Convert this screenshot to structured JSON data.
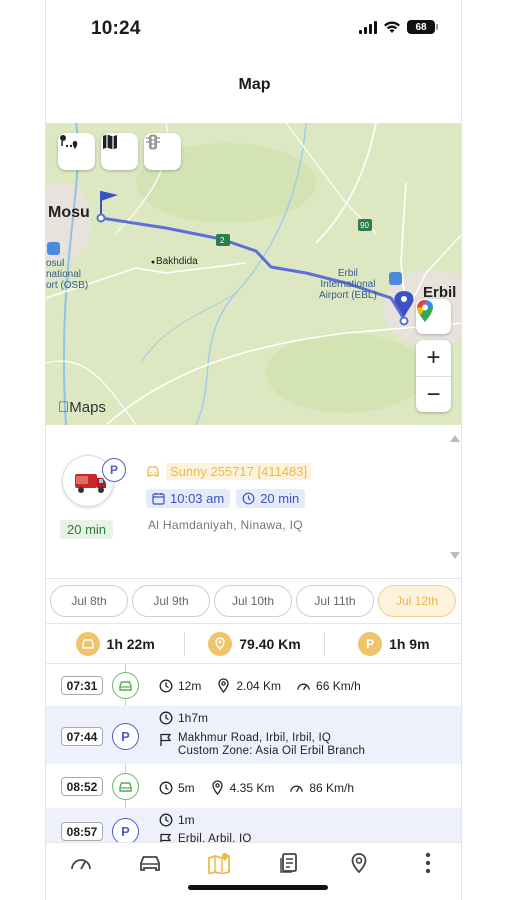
{
  "status_bar": {
    "time": "10:24",
    "battery": "68"
  },
  "page": {
    "title": "Map"
  },
  "map": {
    "labels": {
      "mosul": "Mosu",
      "mosul_airport": "osul\nnational\nort (OSB)",
      "bakhdida": "Bakhdida",
      "erbil_airport": "Erbil\nInternational\nAirport (EBL)",
      "erbil": "Erbil",
      "road_2": "2",
      "road_90": "90"
    },
    "attribution": "Maps",
    "controls": {
      "zoom_in": "+",
      "zoom_out": "−"
    }
  },
  "vehicle": {
    "badge": "P",
    "duration": "20 min",
    "name": "Sunny 255717 [411483]",
    "start_time": "10:03 am",
    "elapsed": "20 min",
    "address": "Al Hamdaniyah, Ninawa, IQ"
  },
  "dates": [
    "Jul 8th",
    "Jul 9th",
    "Jul 10th",
    "Jul 11th",
    "Jul 12th"
  ],
  "active_date": "Jul 12th",
  "summary": {
    "drive_time": "1h 22m",
    "distance": "79.40 Km",
    "parking_badge": "P",
    "parked_time": "1h 9m"
  },
  "timeline": [
    {
      "time": "07:31",
      "type": "move",
      "duration": "12m",
      "distance": "2.04 Km",
      "speed": "66 Km/h"
    },
    {
      "time": "07:44",
      "type": "park",
      "badge": "P",
      "duration": "1h7m",
      "address_line1": "Makhmur Road, Irbil, Irbil, IQ",
      "address_line2": "Custom Zone: Asia Oil Erbil Branch"
    },
    {
      "time": "08:52",
      "type": "move",
      "duration": "5m",
      "distance": "4.35 Km",
      "speed": "86 Km/h"
    },
    {
      "time": "08:57",
      "type": "park",
      "badge": "P",
      "duration": "1m",
      "address_line1": "Erbil, Arbil, IQ"
    }
  ],
  "colors": {
    "accent_yellow": "#f0c46c",
    "accent_blue": "#4b5fc4",
    "green": "#4caf50",
    "route": "#5b6fd6"
  },
  "tabs": [
    "speedometer-icon",
    "car-icon",
    "map-icon",
    "report-icon",
    "location-pin-icon",
    "more-icon"
  ],
  "active_tab": "map-icon"
}
